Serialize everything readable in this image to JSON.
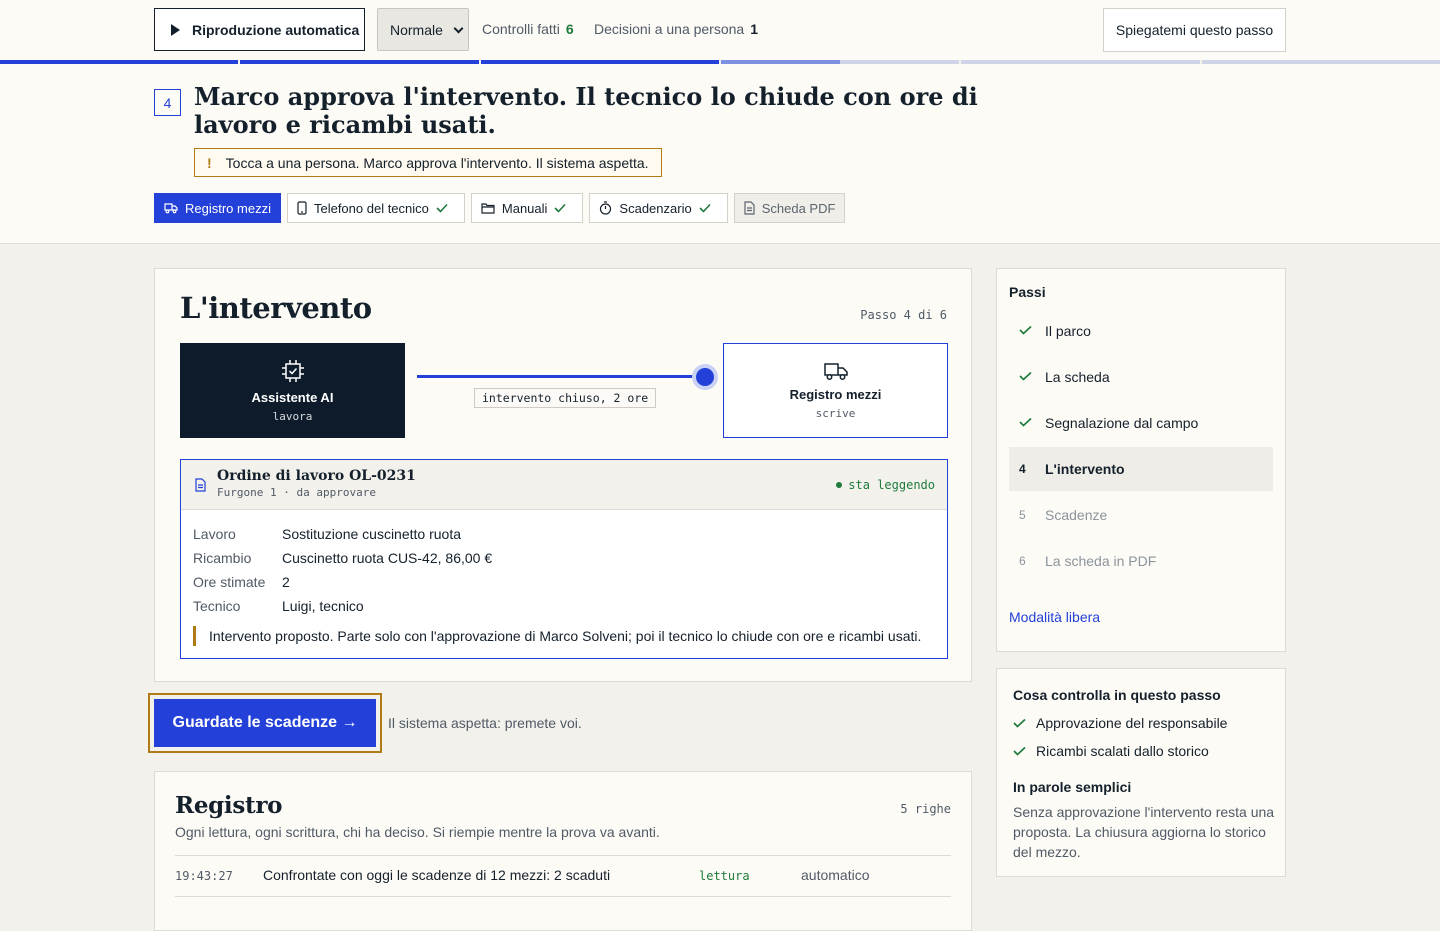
{
  "topbar": {
    "autoplay_label": "Riproduzione automatica",
    "speed_value": "Normale",
    "checks_label": "Controlli fatti",
    "checks_count": "6",
    "decisions_label": "Decisioni a una persona",
    "decisions_count": "1",
    "explain_label": "Spiegatemi questo passo"
  },
  "progress": {
    "segments_total": 6,
    "completed": 3,
    "current": 4,
    "current_fill": 0.5,
    "colors": {
      "done": "#2340d8",
      "current": "#7d8fe0",
      "todo": "#cfd5e6"
    }
  },
  "step": {
    "number": "4",
    "title": "Marco approva l'intervento. Il tecnico lo chiude con ore di lavoro e ricambi usati.",
    "warning": "Tocca a una persona. Marco approva l'intervento. Il sistema aspetta."
  },
  "tools": [
    {
      "label": "Registro mezzi",
      "icon": "truck-icon",
      "state": "active"
    },
    {
      "label": "Telefono del tecnico",
      "icon": "phone-icon",
      "state": "checked"
    },
    {
      "label": "Manuali",
      "icon": "folder-icon",
      "state": "checked"
    },
    {
      "label": "Scadenzario",
      "icon": "stopwatch-icon",
      "state": "checked"
    },
    {
      "label": "Scheda PDF",
      "icon": "document-icon",
      "state": "disabled"
    }
  ],
  "main": {
    "heading": "L'intervento",
    "step_counter": "Passo 4 di 6",
    "flow": {
      "source": {
        "label": "Assistente AI",
        "status": "lavora",
        "icon": "chip-icon"
      },
      "target": {
        "label": "Registro mezzi",
        "status": "scrive",
        "icon": "truck-icon"
      },
      "edge_label": "intervento chiuso, 2 ore"
    },
    "order": {
      "title": "Ordine di lavoro OL-0231",
      "subtitle": "Furgone 1 · da approvare",
      "status": "sta leggendo",
      "fields": [
        {
          "key": "Lavoro",
          "value": "Sostituzione cuscinetto ruota"
        },
        {
          "key": "Ricambio",
          "value": "Cuscinetto ruota CUS-42, 86,00 €"
        },
        {
          "key": "Ore stimate",
          "value": "2"
        },
        {
          "key": "Tecnico",
          "value": "Luigi, tecnico"
        }
      ],
      "note": "Intervento proposto. Parte solo con l'approvazione di Marco Solveni; poi il tecnico lo chiude con ore e ricambi usati."
    },
    "cta_label": "Guardate le scadenze →",
    "cta_note": "Il sistema aspetta: premete voi."
  },
  "log": {
    "heading": "Registro",
    "count": "5 righe",
    "subtitle": "Ogni lettura, ogni scrittura, chi ha deciso. Si riempie mentre la prova va avanti.",
    "rows": [
      {
        "time": "19:43:27",
        "message": "Confrontate con oggi le scadenze di 12 mezzi: 2 scaduti",
        "kind": "lettura",
        "actor": "automatico"
      }
    ]
  },
  "steps": {
    "heading": "Passi",
    "items": [
      {
        "num": "",
        "label": "Il parco",
        "state": "done"
      },
      {
        "num": "",
        "label": "La scheda",
        "state": "done"
      },
      {
        "num": "",
        "label": "Segnalazione dal campo",
        "state": "done"
      },
      {
        "num": "4",
        "label": "L'intervento",
        "state": "current"
      },
      {
        "num": "5",
        "label": "Scadenze",
        "state": "todo"
      },
      {
        "num": "6",
        "label": "La scheda in PDF",
        "state": "todo"
      }
    ],
    "free_mode": "Modalità libera"
  },
  "checks": {
    "heading": "Cosa controlla in questo passo",
    "items": [
      "Approvazione del responsabile",
      "Ricambi scalati dallo storico"
    ],
    "plain_heading": "In parole semplici",
    "plain_text": "Senza approvazione l'intervento resta una proposta. La chiusura aggiorna lo storico del mezzo."
  },
  "colors": {
    "accent": "#2340d8",
    "warning": "#b07a14",
    "success": "#1e7b3c",
    "dark": "#0d1b2a"
  }
}
